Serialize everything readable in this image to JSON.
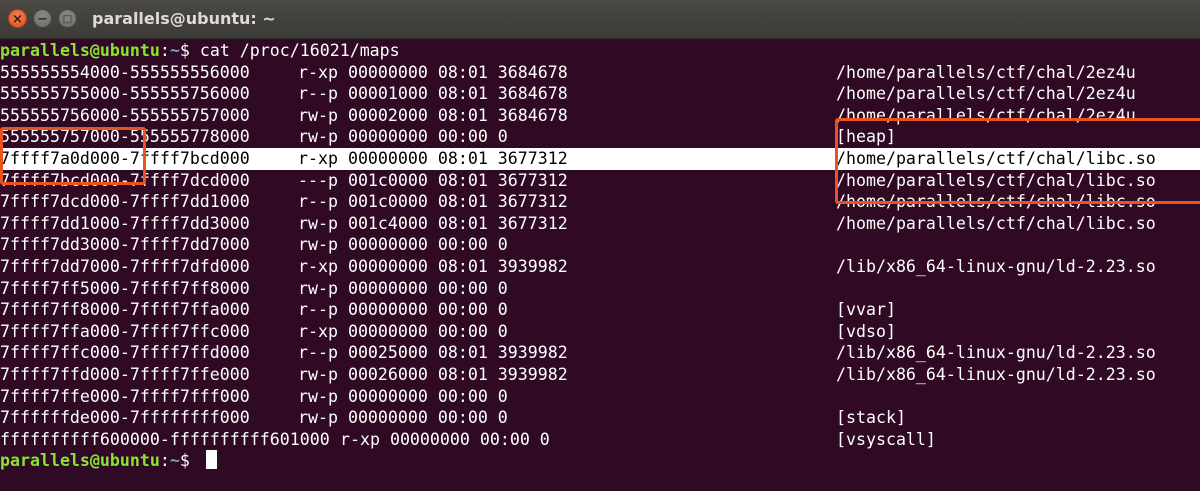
{
  "window": {
    "title": "parallels@ubuntu: ~",
    "close_glyph": "×",
    "minimize_glyph": "−",
    "maximize_glyph": "□"
  },
  "terminal": {
    "colors": {
      "background": "#300a24",
      "prompt_user": "#8ae234",
      "prompt_path": "#729fcf",
      "highlight_box": "#e8531f"
    },
    "prompt1": {
      "user": "parallels@ubuntu",
      "colon": ":",
      "path": "~",
      "symbol": "$ ",
      "command": "cat /proc/16021/maps"
    },
    "rows": [
      {
        "addr": "555555554000-555555556000",
        "perms": "r-xp 00000000 08:01 3684678",
        "path": "/home/parallels/ctf/chal/2ez4u"
      },
      {
        "addr": "555555755000-555555756000",
        "perms": "r--p 00001000 08:01 3684678",
        "path": "/home/parallels/ctf/chal/2ez4u"
      },
      {
        "addr": "555555756000-555555757000",
        "perms": "rw-p 00002000 08:01 3684678",
        "path": "/home/parallels/ctf/chal/2ez4u"
      },
      {
        "addr": "555555757000-555555778000",
        "perms": "rw-p 00000000 00:00 0",
        "path": "[heap]"
      },
      {
        "addr": "7ffff7a0d000-7ffff7bcd000",
        "perms": "r-xp 00000000 08:01 3677312",
        "path": "/home/parallels/ctf/chal/libc.so"
      },
      {
        "addr": "7ffff7bcd000-7ffff7dcd000",
        "perms": "---p 001c0000 08:01 3677312",
        "path": "/home/parallels/ctf/chal/libc.so"
      },
      {
        "addr": "7ffff7dcd000-7ffff7dd1000",
        "perms": "r--p 001c0000 08:01 3677312",
        "path": "/home/parallels/ctf/chal/libc.so"
      },
      {
        "addr": "7ffff7dd1000-7ffff7dd3000",
        "perms": "rw-p 001c4000 08:01 3677312",
        "path": "/home/parallels/ctf/chal/libc.so"
      },
      {
        "addr": "7ffff7dd3000-7ffff7dd7000",
        "perms": "rw-p 00000000 00:00 0",
        "path": ""
      },
      {
        "addr": "7ffff7dd7000-7ffff7dfd000",
        "perms": "r-xp 00000000 08:01 3939982",
        "path": "/lib/x86_64-linux-gnu/ld-2.23.so"
      },
      {
        "addr": "7ffff7ff5000-7ffff7ff8000",
        "perms": "rw-p 00000000 00:00 0",
        "path": ""
      },
      {
        "addr": "7ffff7ff8000-7ffff7ffa000",
        "perms": "r--p 00000000 00:00 0",
        "path": "[vvar]"
      },
      {
        "addr": "7ffff7ffa000-7ffff7ffc000",
        "perms": "r-xp 00000000 00:00 0",
        "path": "[vdso]"
      },
      {
        "addr": "7ffff7ffc000-7ffff7ffd000",
        "perms": "r--p 00025000 08:01 3939982",
        "path": "/lib/x86_64-linux-gnu/ld-2.23.so"
      },
      {
        "addr": "7ffff7ffd000-7ffff7ffe000",
        "perms": "rw-p 00026000 08:01 3939982",
        "path": "/lib/x86_64-linux-gnu/ld-2.23.so"
      },
      {
        "addr": "7ffff7ffe000-7ffff7fff000",
        "perms": "rw-p 00000000 00:00 0",
        "path": ""
      },
      {
        "addr": "7ffffffde000-7ffffffff000",
        "perms": "rw-p 00000000 00:00 0",
        "path": "[stack]"
      },
      {
        "addr": "ffffffffff600000-ffffffffff601000",
        "perms": "r-xp 00000000 00:00 0",
        "path": "[vsyscall]"
      }
    ],
    "selected_row": 4,
    "prompt2": {
      "user": "parallels@ubuntu",
      "colon": ":",
      "path": "~",
      "symbol": "$ "
    }
  }
}
